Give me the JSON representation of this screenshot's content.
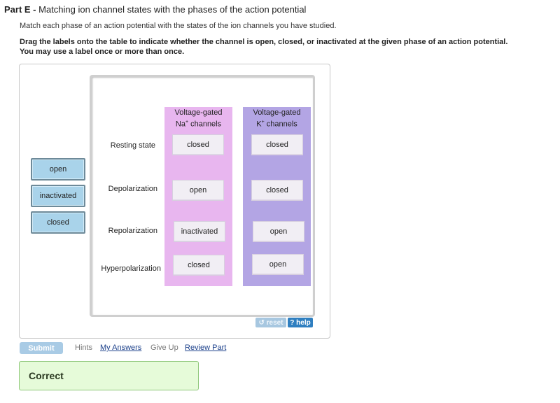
{
  "header": {
    "part_label": "Part E -",
    "part_title": "Matching ion channel states with the phases of the action potential",
    "intro": "Match each phase of an action potential with the states of the ion channels you have studied.",
    "instructions_line1": "Drag the labels onto the table to indicate whether the channel is open, closed, or inactivated at the given phase of an action potential.",
    "instructions_line2": "You may use a label once or more than once."
  },
  "labels": [
    "open",
    "inactivated",
    "closed"
  ],
  "table": {
    "columns": [
      {
        "line1": "Voltage-gated",
        "line2_prefix": "Na",
        "line2_sup": "+",
        "line2_suffix": " channels"
      },
      {
        "line1": "Voltage-gated",
        "line2_prefix": "K",
        "line2_sup": "+",
        "line2_suffix": " channels"
      }
    ],
    "rows": [
      {
        "phase": "Resting state",
        "na": "closed",
        "k": "closed"
      },
      {
        "phase": "Depolarization",
        "na": "open",
        "k": "closed"
      },
      {
        "phase": "Repolarization",
        "na": "inactivated",
        "k": "open"
      },
      {
        "phase": "Hyperpolarization",
        "na": "closed",
        "k": "open"
      }
    ]
  },
  "controls": {
    "reset": "↺ reset",
    "help": "? help"
  },
  "footer": {
    "submit": "Submit",
    "hints": "Hints",
    "my_answers": "My Answers",
    "give_up": "Give Up",
    "review_part": "Review Part"
  },
  "feedback": "Correct",
  "colors": {
    "na_column": "#e8b6ef",
    "k_column": "#b3a5e4",
    "label_chip": "#a9d3ea",
    "correct_bg": "#e6fbd9"
  }
}
